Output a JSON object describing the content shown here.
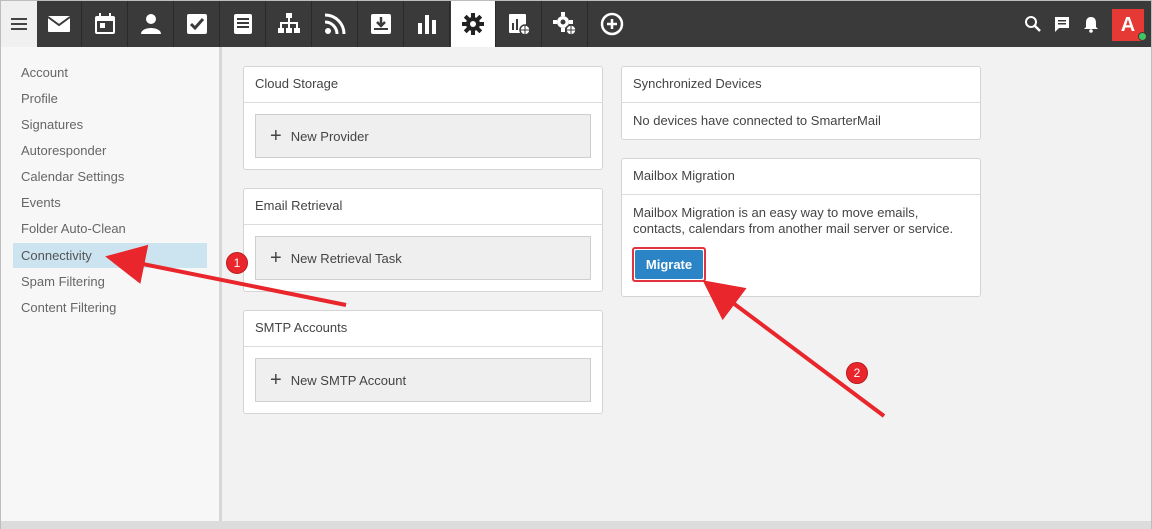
{
  "topbar": {
    "menu_icon": "hamburger-icon",
    "nav_icons": [
      "mail-icon",
      "calendar-icon",
      "contacts-icon",
      "tasks-icon",
      "notes-icon",
      "sitemap-icon",
      "rss-icon",
      "download-box-icon",
      "bar-chart-icon",
      "gear-icon",
      "report-globe-icon",
      "gear-globe-icon",
      "plus-circle-icon"
    ],
    "active_icon": "gear-icon",
    "right_icons": [
      "search-icon",
      "chat-icon",
      "bell-icon"
    ],
    "avatar_letter": "A",
    "avatar_color": "#e53935",
    "status_color": "#43c463"
  },
  "sidebar": {
    "items": [
      {
        "label": "Account"
      },
      {
        "label": "Profile"
      },
      {
        "label": "Signatures"
      },
      {
        "label": "Autoresponder"
      },
      {
        "label": "Calendar Settings"
      },
      {
        "label": "Events"
      },
      {
        "label": "Folder Auto-Clean"
      },
      {
        "label": "Connectivity"
      },
      {
        "label": "Spam Filtering"
      },
      {
        "label": "Content Filtering"
      }
    ],
    "selected": "Connectivity"
  },
  "main": {
    "cloud_storage": {
      "title": "Cloud Storage",
      "button": "New Provider"
    },
    "email_retrieval": {
      "title": "Email Retrieval",
      "button": "New Retrieval Task"
    },
    "smtp_accounts": {
      "title": "SMTP Accounts",
      "button": "New SMTP Account"
    },
    "synchronized_devices": {
      "title": "Synchronized Devices",
      "text": "No devices have connected to SmarterMail"
    },
    "mailbox_migration": {
      "title": "Mailbox Migration",
      "text": "Mailbox Migration is an easy way to move emails, contacts, calendars from another mail server or service.",
      "button": "Migrate"
    }
  },
  "annotations": {
    "badge_1": "1",
    "badge_2": "2",
    "color": "#e8262c"
  }
}
